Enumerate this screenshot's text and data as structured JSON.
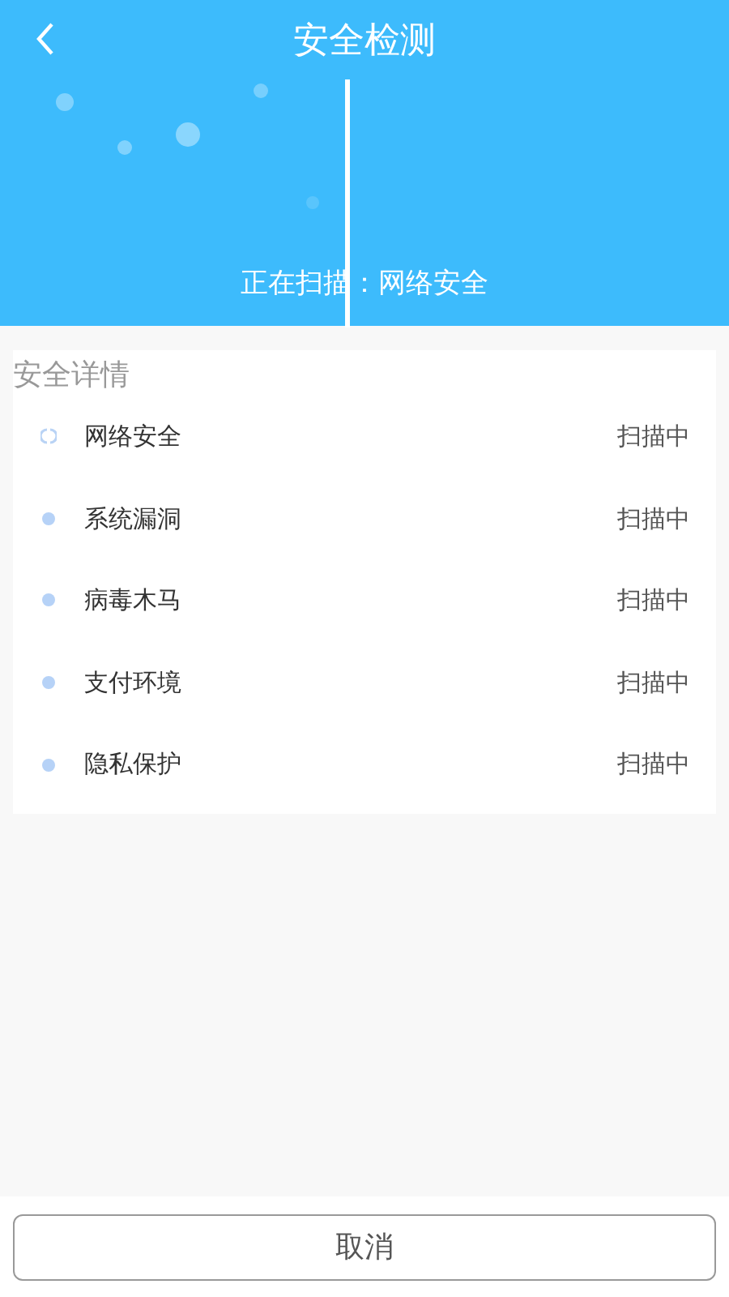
{
  "header": {
    "title": "安全检测",
    "scan_status": "正在扫描：网络安全"
  },
  "details": {
    "heading": "安全详情",
    "items": [
      {
        "name": "网络安全",
        "status": "扫描中",
        "kind": "scanning"
      },
      {
        "name": "系统漏洞",
        "status": "扫描中",
        "kind": "pending"
      },
      {
        "name": "病毒木马",
        "status": "扫描中",
        "kind": "pending"
      },
      {
        "name": "支付环境",
        "status": "扫描中",
        "kind": "pending"
      },
      {
        "name": "隐私保护",
        "status": "扫描中",
        "kind": "pending"
      }
    ]
  },
  "cancel_button": "取消"
}
